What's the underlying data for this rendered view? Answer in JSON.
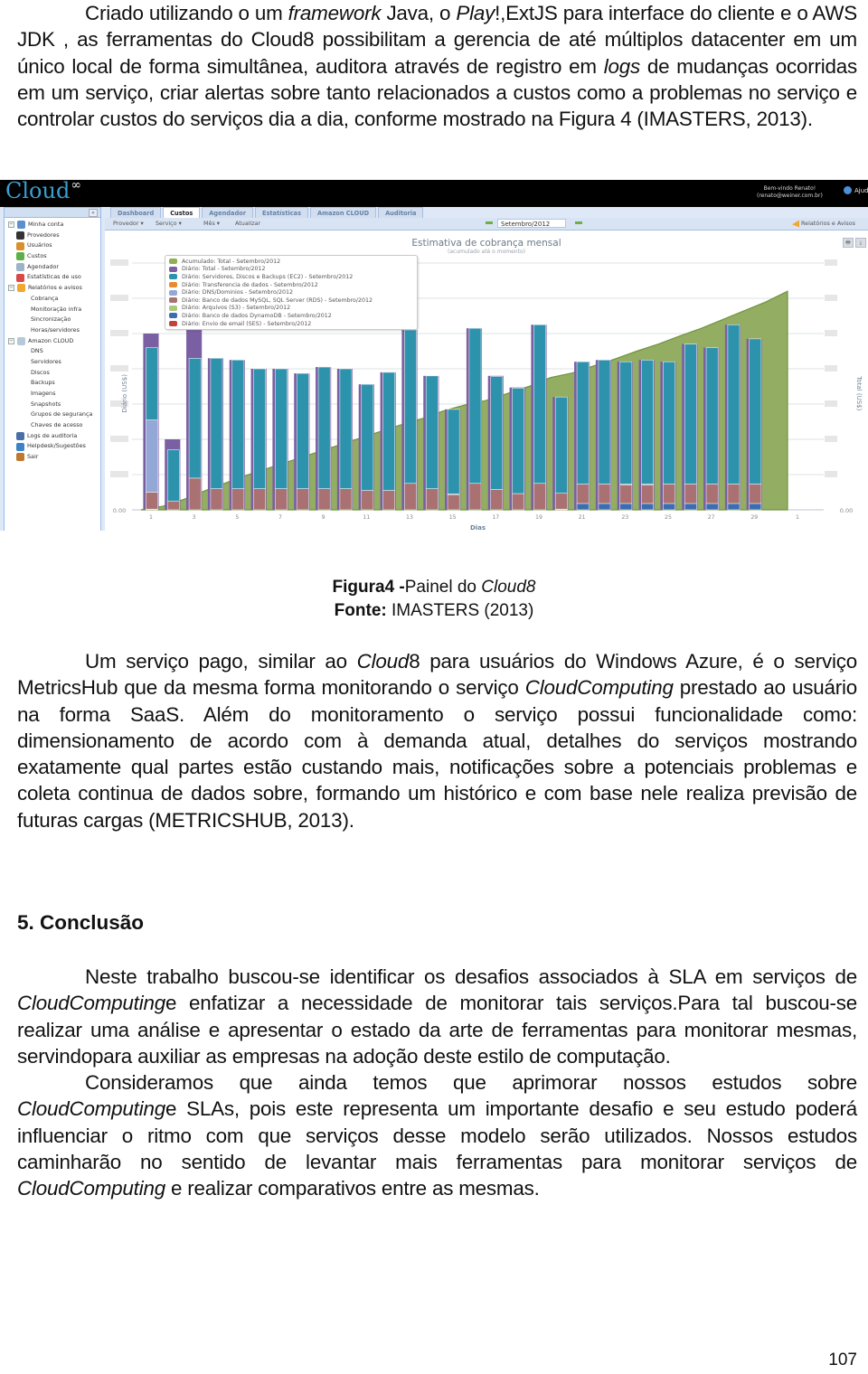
{
  "paragraphs": {
    "intro": [
      {
        "text": "Criado utilizando o um ",
        "italic": false
      },
      {
        "text": "framework",
        "italic": true
      },
      {
        "text": " Java, o ",
        "italic": false
      },
      {
        "text": "Play",
        "italic": true
      },
      {
        "text": "!,ExtJS para interface do cliente e o AWS JDK , as ferramentas do Cloud8 possibilitam a gerencia de até múltiplos datacenter em um único local de forma simultânea, auditora através de registro em ",
        "italic": false
      },
      {
        "text": "logs",
        "italic": true
      },
      {
        "text": " de mudanças ocorridas em um serviço, criar alertas sobre tanto relacionados a custos como a problemas no serviço e  controlar custos do serviços dia a dia, conforme mostrado na Figura 4 (IMASTERS, 2013).",
        "italic": false
      }
    ],
    "metricshub": [
      {
        "text": "Um serviço pago, similar ao ",
        "italic": false
      },
      {
        "text": "Cloud",
        "italic": true
      },
      {
        "text": "8 para usuários do Windows Azure, é o serviço MetricsHub que da mesma forma monitorando o serviço ",
        "italic": false
      },
      {
        "text": "CloudComputing",
        "italic": true
      },
      {
        "text": " prestado ao usuário na forma SaaS. Além do monitoramento o serviço possui funcionalidade como: dimensionamento de acordo com à demanda atual, detalhes do serviços mostrando exatamente qual partes estão custando mais, notificações sobre a potenciais problemas e coleta continua de dados sobre, formando um histórico e com base nele realiza previsão de futuras cargas (METRICSHUB, 2013).",
        "italic": false
      }
    ],
    "conclusion_1": [
      {
        "text": "Neste trabalho buscou-se identificar os desafios associados à SLA em serviços de ",
        "italic": false
      },
      {
        "text": "CloudComputing",
        "italic": true
      },
      {
        "text": "e enfatizar a necessidade de monitorar tais serviços.Para tal buscou-se realizar uma análise e apresentar o estado da arte de ferramentas para monitorar mesmas, servindopara auxiliar as empresas na adoção deste estilo de computação.",
        "italic": false
      }
    ],
    "conclusion_2": [
      {
        "text": "Consideramos que ainda temos que aprimorar nossos estudos sobre ",
        "italic": false
      },
      {
        "text": "CloudComputing",
        "italic": true
      },
      {
        "text": "e SLAs, pois este representa um importante desafio e seu estudo poderá influenciar o ritmo com que serviços desse modelo serão utilizados. Nossos estudos caminharão no sentido de levantar mais ferramentas para monitorar serviços de ",
        "italic": false
      },
      {
        "text": "CloudComputing",
        "italic": true
      },
      {
        "text": " e realizar comparativos entre as mesmas.",
        "italic": false
      }
    ]
  },
  "caption": {
    "figure_label": "Figura4 -",
    "figure_text": "Painel do ",
    "figure_italic": "Cloud8",
    "source_label": "Fonte:",
    "source_text": " IMASTERS (2013)"
  },
  "section_heading": "5. Conclusão",
  "page_number": "107",
  "app": {
    "logo_text": "Cloud",
    "logo_symbol": "∞",
    "welcome_line1": "Bem-vindo Renato!",
    "welcome_line2": "(renato@weiner.com.br)",
    "help_label": "Ajuda",
    "collapse_label": "«",
    "sidebar": [
      {
        "label": "Minha conta",
        "level": 0,
        "expand": true,
        "icon": "user-icon",
        "color": "#5a8fd0"
      },
      {
        "label": "Provedores",
        "level": 1,
        "icon": "server-icon",
        "color": "#333333"
      },
      {
        "label": "Usuários",
        "level": 1,
        "icon": "users-icon",
        "color": "#d9902f"
      },
      {
        "label": "Custos",
        "level": 1,
        "icon": "dollar-icon",
        "color": "#5cb04a"
      },
      {
        "label": "Agendador",
        "level": 1,
        "icon": "calendar-icon",
        "color": "#9db3c9"
      },
      {
        "label": "Estatísticas de uso",
        "level": 1,
        "icon": "chart-icon",
        "color": "#d84a4a"
      },
      {
        "label": "Relatórios e avisos",
        "level": 0,
        "expand": true,
        "icon": "report-icon",
        "color": "#f0a830"
      },
      {
        "label": "Cobrança",
        "level": 2
      },
      {
        "label": "Monitoração infra",
        "level": 2
      },
      {
        "label": "Sincronização",
        "level": 2
      },
      {
        "label": "Horas/servidores",
        "level": 2
      },
      {
        "label": "Amazon CLOUD",
        "level": 0,
        "expand": true,
        "icon": "cloud-icon",
        "color": "#b8c8d8"
      },
      {
        "label": "DNS",
        "level": 2
      },
      {
        "label": "Servidores",
        "level": 2
      },
      {
        "label": "Discos",
        "level": 2
      },
      {
        "label": "Backups",
        "level": 2
      },
      {
        "label": "Imagens",
        "level": 2
      },
      {
        "label": "Snapshots",
        "level": 2
      },
      {
        "label": "Grupos de segurança",
        "level": 2
      },
      {
        "label": "Chaves de acesso",
        "level": 2
      },
      {
        "label": "Logs de auditoria",
        "level": 1,
        "icon": "log-icon",
        "color": "#4a6fa8"
      },
      {
        "label": "Helpdesk/Sugestões",
        "level": 1,
        "icon": "help-icon",
        "color": "#3b82c8"
      },
      {
        "label": "Sair",
        "level": 1,
        "icon": "exit-icon",
        "color": "#c0772f"
      }
    ],
    "tabs": [
      {
        "label": "Dashboard",
        "active": false
      },
      {
        "label": "Custos",
        "active": true
      },
      {
        "label": "Agendador",
        "active": false
      },
      {
        "label": "Estatísticas",
        "active": false
      },
      {
        "label": "Amazon CLOUD",
        "active": false
      },
      {
        "label": "Auditoria",
        "active": false
      }
    ],
    "toolbar": {
      "provider": "Provedor ▾",
      "service": "Serviço ▾",
      "month": "Mês ▾",
      "refresh": "Atualizar",
      "selected_month": "Setembro/2012",
      "reports": "Relatórios e Avisos"
    },
    "print_label": "🖶",
    "download_label": "⤓"
  },
  "chart_data": {
    "type": "bar",
    "title": "Estimativa de cobrança mensal",
    "subtitle": "(acumulado até o momento)",
    "xlabel": "Dias",
    "ylabel": "Diário (US$)",
    "y2label": "Total (US$)",
    "y_tick_labels_visible": [
      "0.00"
    ],
    "y2_tick_labels_visible": [
      "0.00"
    ],
    "y_units_note": "tick values blurred in source; values below are in gridline units (0 = baseline, 1 = one gridline)",
    "ylim": [
      0,
      7
    ],
    "x_tick_labels": [
      "1",
      "3",
      "5",
      "7",
      "9",
      "11",
      "13",
      "15",
      "17",
      "19",
      "21",
      "23",
      "25",
      "27",
      "29",
      "1"
    ],
    "categories": [
      1,
      2,
      3,
      4,
      5,
      6,
      7,
      8,
      9,
      10,
      11,
      12,
      13,
      14,
      15,
      16,
      17,
      18,
      19,
      20,
      21,
      22,
      23,
      24,
      25,
      26,
      27,
      28,
      29
    ],
    "legend": [
      {
        "name": "Acumulado: Total - Setembro/2012",
        "color": "#8fb050"
      },
      {
        "name": "Diário: Total - Setembro/2012",
        "color": "#7b5fa3"
      },
      {
        "name": "Diário: Servidores, Discos e Backups (EC2) - Setembro/2012",
        "color": "#2d93ad"
      },
      {
        "name": "Diário: Transferencia de dados - Setembro/2012",
        "color": "#e88a2e"
      },
      {
        "name": "Diário: DNS/Dominios - Setembro/2012",
        "color": "#93a8d6"
      },
      {
        "name": "Diário: Banco de dados MySQL, SQL Server (RDS) - Setembro/2012",
        "color": "#a97172"
      },
      {
        "name": "Diário: Arquivos (S3) - Setembro/2012",
        "color": "#a9c97d"
      },
      {
        "name": "Diário: Banco de dados DynamoDB - Setembro/2012",
        "color": "#3a6eb0"
      },
      {
        "name": "Diário: Envio de email (SES) - Setembro/2012",
        "color": "#c0433a"
      }
    ],
    "series": [
      {
        "name": "Diário: Total",
        "values": [
          5.0,
          2.0,
          5.1,
          4.3,
          4.25,
          4.0,
          4.0,
          3.87,
          4.05,
          4.0,
          3.56,
          3.9,
          5.1,
          3.8,
          2.85,
          5.15,
          3.8,
          3.47,
          5.25,
          3.2,
          4.2,
          4.25,
          4.2,
          4.25,
          4.2,
          4.7,
          4.6,
          5.25,
          4.85
        ]
      },
      {
        "name": "Diário: EC2",
        "values": [
          2.05,
          1.45,
          3.4,
          3.7,
          3.65,
          3.4,
          3.4,
          3.27,
          3.45,
          3.4,
          3.01,
          3.35,
          4.35,
          3.2,
          2.4,
          4.4,
          3.2,
          2.99,
          4.5,
          2.73,
          3.47,
          3.52,
          3.47,
          3.52,
          3.47,
          3.97,
          3.87,
          4.52,
          4.12
        ]
      },
      {
        "name": "Diário: DNS/Dominios",
        "values": [
          2.05,
          0,
          0,
          0,
          0,
          0,
          0,
          0,
          0,
          0,
          0,
          0,
          0,
          0,
          0.02,
          0,
          0,
          0,
          0,
          0,
          0,
          0,
          0.02,
          0.02,
          0,
          0,
          0,
          0,
          0
        ]
      },
      {
        "name": "Diário: RDS",
        "values": [
          0.48,
          0.25,
          0.9,
          0.6,
          0.6,
          0.6,
          0.6,
          0.6,
          0.6,
          0.6,
          0.55,
          0.55,
          0.75,
          0.6,
          0.43,
          0.75,
          0.58,
          0.46,
          0.75,
          0.45,
          0.55,
          0.55,
          0.53,
          0.53,
          0.55,
          0.55,
          0.55,
          0.55,
          0.55
        ]
      },
      {
        "name": "Diário: S3",
        "values": [
          0.02,
          0,
          0,
          0,
          0,
          0,
          0,
          0,
          0,
          0,
          0,
          0,
          0,
          0,
          0,
          0,
          0,
          0,
          0,
          0.02,
          0,
          0,
          0,
          0,
          0,
          0,
          0,
          0,
          0
        ]
      },
      {
        "name": "Diário: DynamoDB",
        "values": [
          0,
          0,
          0,
          0,
          0,
          0,
          0,
          0,
          0,
          0,
          0,
          0,
          0,
          0,
          0,
          0,
          0,
          0,
          0,
          0,
          0.18,
          0.18,
          0.18,
          0.18,
          0.18,
          0.18,
          0.18,
          0.18,
          0.18
        ]
      },
      {
        "name": "Acumulado: Total",
        "values": [
          0.1,
          0.3,
          0.55,
          0.78,
          1.0,
          1.2,
          1.4,
          1.6,
          1.8,
          2.0,
          2.2,
          2.4,
          2.58,
          2.8,
          2.97,
          3.1,
          3.3,
          3.5,
          3.75,
          3.88,
          4.08,
          4.28,
          4.5,
          4.7,
          4.93,
          5.15,
          5.4,
          5.65,
          5.9,
          6.2
        ]
      }
    ],
    "grid": true,
    "legend_position": "top-left"
  }
}
